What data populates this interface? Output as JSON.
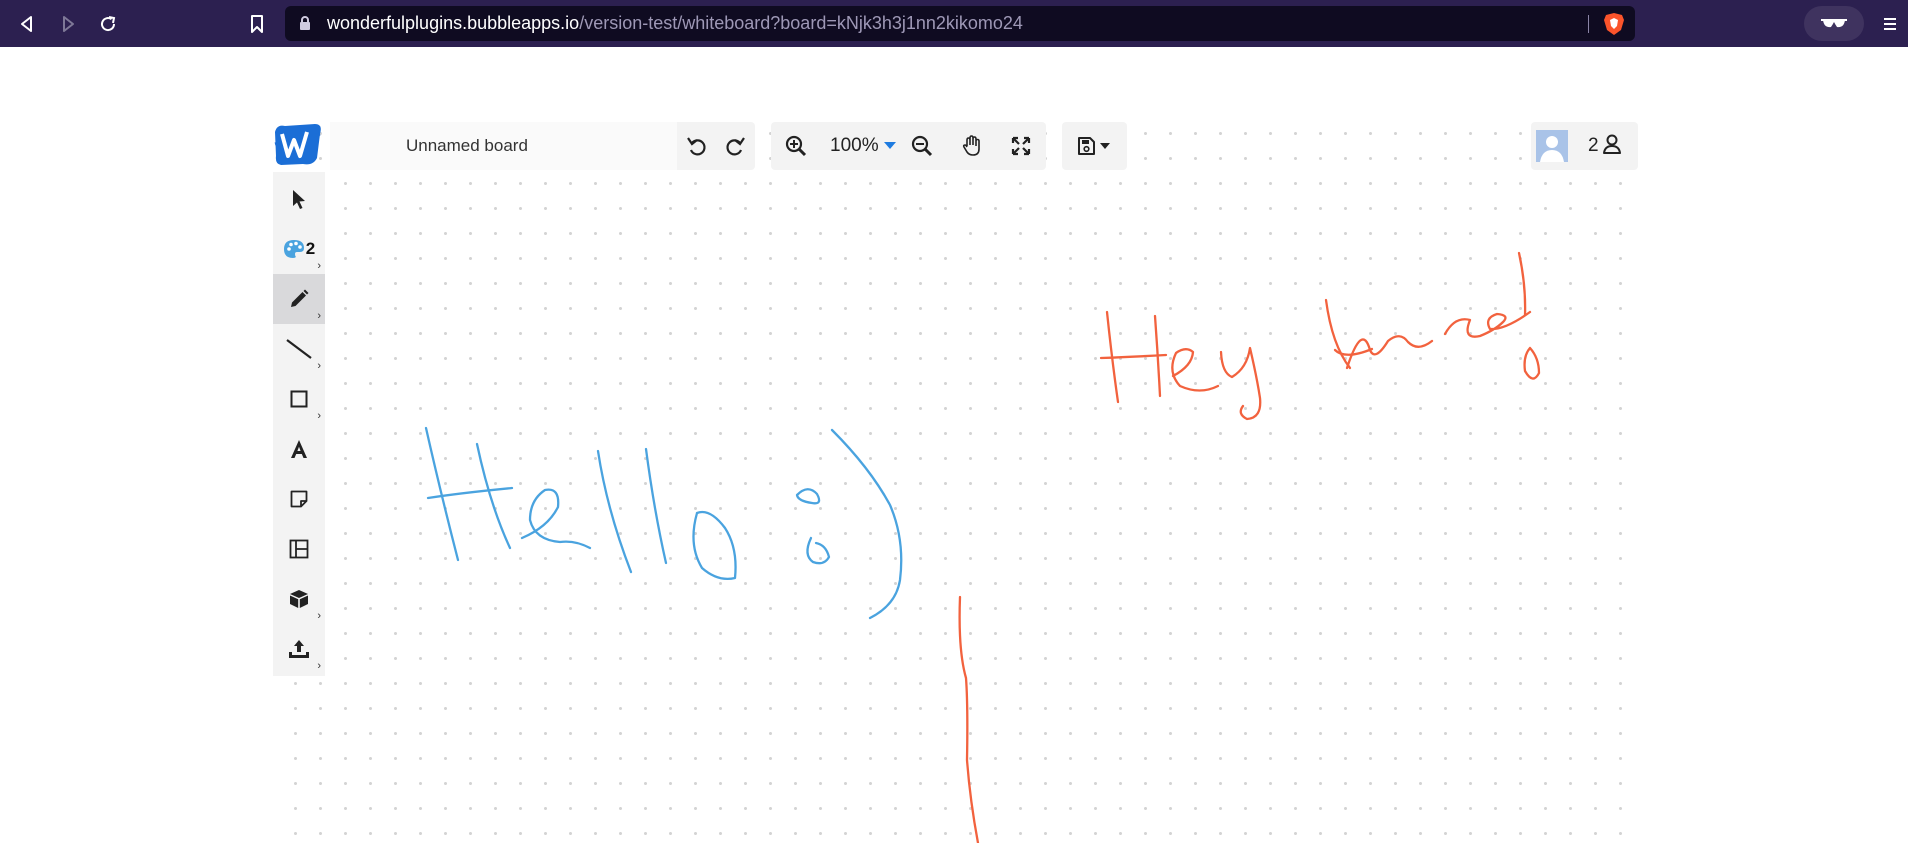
{
  "browser": {
    "url_host": "wonderfulplugins.bubbleapps.io",
    "url_path": "/version-test/whiteboard?board=kNjk3h3j1nn2kikomo24",
    "icons": [
      "back-icon",
      "forward-icon",
      "reload-icon",
      "bookmark-icon",
      "lock-icon",
      "brave-shield-icon",
      "private-window-icon",
      "menu-icon"
    ]
  },
  "toolbar": {
    "board_name": "Unnamed board",
    "zoom_level": "100%",
    "icons": [
      "hamburger-menu-icon",
      "undo-icon",
      "redo-icon",
      "zoom-in-icon",
      "zoom-out-icon",
      "pan-hand-icon",
      "fit-screen-icon",
      "save-icon"
    ]
  },
  "left_tools": {
    "color_badge": "2",
    "active_tool": "pen",
    "tools": [
      "select",
      "color",
      "pen",
      "line",
      "shape",
      "text",
      "sticky-note",
      "template",
      "3d-object",
      "upload"
    ]
  },
  "users": {
    "online_count": "2"
  },
  "canvas": {
    "ink_colors": {
      "blue": "#4aa3df",
      "orange": "#f2623e"
    },
    "handwriting": [
      "Hello :)",
      "Hey there!"
    ]
  },
  "colors": {
    "browser_bar": "#2c2050",
    "url_field": "#0f0b21",
    "panel_bg": "#f3f3f3",
    "zoom_accent": "#1e7be0"
  }
}
